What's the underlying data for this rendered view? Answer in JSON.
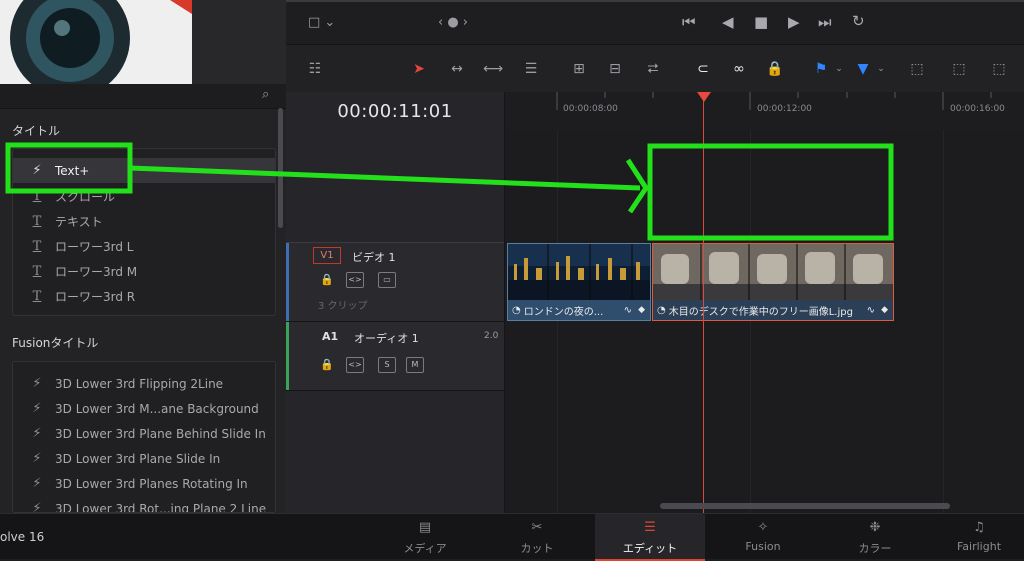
{
  "app": {
    "title_fragment": "olve 16"
  },
  "effects_panel": {
    "titles_section": "タイトル",
    "titles": [
      {
        "icon": "lightning-icon",
        "label": "Text+"
      },
      {
        "icon": "text-icon",
        "label": "スクロール"
      },
      {
        "icon": "text-icon",
        "label": "テキスト"
      },
      {
        "icon": "text-icon",
        "label": "ローワー3rd L"
      },
      {
        "icon": "text-icon",
        "label": "ローワー3rd M"
      },
      {
        "icon": "text-icon",
        "label": "ローワー3rd R"
      }
    ],
    "fusion_section": "Fusionタイトル",
    "fusion_titles": [
      {
        "icon": "lightning-icon",
        "label": "3D Lower 3rd Flipping 2Line"
      },
      {
        "icon": "lightning-icon",
        "label": "3D Lower 3rd M...ane Background"
      },
      {
        "icon": "lightning-icon",
        "label": "3D Lower 3rd Plane Behind Slide In"
      },
      {
        "icon": "lightning-icon",
        "label": "3D Lower 3rd Plane Slide In"
      },
      {
        "icon": "lightning-icon",
        "label": "3D Lower 3rd Planes Rotating In"
      },
      {
        "icon": "lightning-icon",
        "label": "3D Lower 3rd Rot...ing Plane 2 Line"
      }
    ]
  },
  "timeline": {
    "timecode": "00:00:11:01",
    "ruler_labels": [
      "00:00:08:00",
      "00:00:12:00",
      "00:00:16:00"
    ],
    "video_track": {
      "id": "V1",
      "name": "ビデオ 1",
      "clip_count": "3 クリップ"
    },
    "audio_track": {
      "id": "A1",
      "name": "オーディオ 1",
      "channels": "2.0",
      "solo": "S",
      "mute": "M"
    },
    "clips": [
      {
        "name": "ロンドンの夜の..."
      },
      {
        "name": "木目のデスクで作業中のフリー画像L.jpg"
      }
    ]
  },
  "bottom_nav": {
    "tabs": [
      {
        "label": "メディア",
        "icon": "media-icon"
      },
      {
        "label": "カット",
        "icon": "cut-icon"
      },
      {
        "label": "エディット",
        "icon": "edit-icon",
        "active": true
      },
      {
        "label": "Fusion",
        "icon": "fusion-icon"
      },
      {
        "label": "カラー",
        "icon": "color-icon"
      },
      {
        "label": "Fairlight",
        "icon": "fairlight-icon"
      }
    ]
  },
  "colors": {
    "accent": "#e0452f",
    "annotation": "#22e01a",
    "clip_blue": "#3e5a78",
    "clip_selected_border": "#e05a40"
  }
}
